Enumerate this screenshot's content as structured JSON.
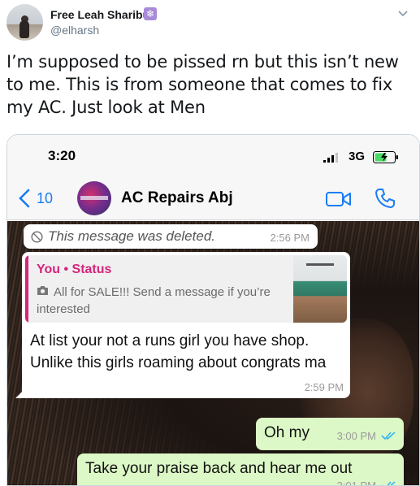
{
  "tweet": {
    "author_name": "Free Leah Sharibu",
    "badge_icon": "snowflake-icon",
    "handle": "@elharsh",
    "text": "I’m supposed to be pissed rn but this isn’t new to me. This is from someone that comes to fix my AC. Just look at Men"
  },
  "phone": {
    "time": "3:20",
    "network": "3G"
  },
  "chat": {
    "back_count": "10",
    "contact_name": "AC Repairs Abj",
    "messages": {
      "deleted": {
        "text": "This message was deleted.",
        "time": "2:56 PM"
      },
      "reply": {
        "quote_author": "You • Status",
        "quote_text": "All for SALE!!! Send a message if you’re interested",
        "text": "At list your not a runs girl you have shop. Unlike this girls roaming about congrats ma",
        "time": "2:59 PM"
      },
      "out1": {
        "text": "Oh my",
        "time": "3:00 PM"
      },
      "out2": {
        "text": "Take your praise back and hear me out",
        "time": "3:01 PM"
      }
    }
  },
  "colors": {
    "accent_blue": "#1a7cf5",
    "status_pink": "#d3257b",
    "outgoing_bubble": "#dcf8c6",
    "read_ticks": "#34b7f1"
  }
}
